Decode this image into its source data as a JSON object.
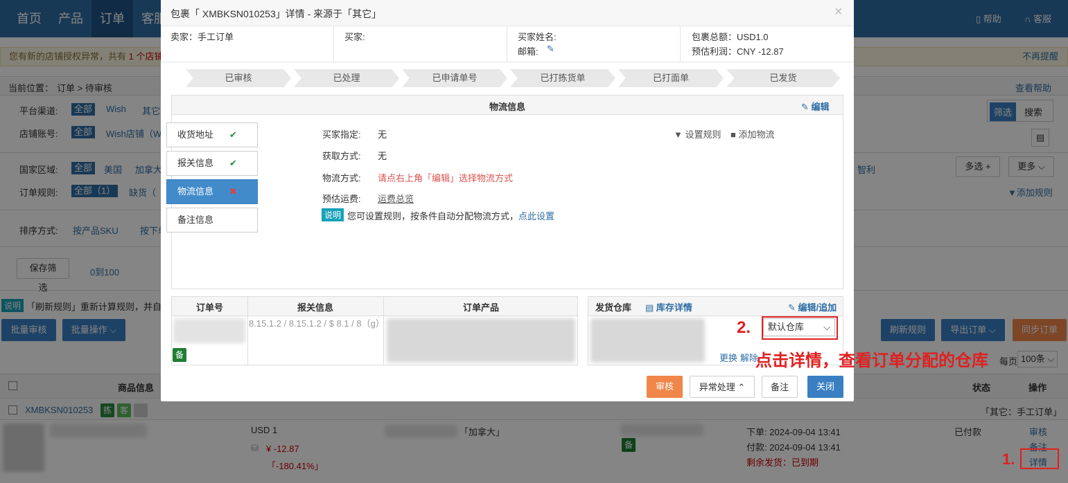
{
  "nav": {
    "items": [
      "首页",
      "产品",
      "订单",
      "客服"
    ],
    "help": "帮助",
    "service": "客服"
  },
  "notice": {
    "text_prefix": "您有新的店铺授权异常，共有",
    "text_count": "1 个店铺",
    "dismiss": "不再提醒"
  },
  "breadcrumb": {
    "label": "当前位置：",
    "path": "订单 > 待审核",
    "help": "查看帮助"
  },
  "filters": {
    "platform_label": "平台渠道:",
    "platform_all": "全部",
    "platform_wish": "Wish",
    "platform_other": "其它",
    "shop_label": "店铺账号:",
    "shop_all": "全部",
    "shop_wish": "Wish店铺（W",
    "region_label": "国家区域:",
    "region_all": "全部",
    "region_us": "美国",
    "region_ca": "加拿大",
    "region_cl": "智利",
    "multi": "多选 +",
    "more": "更多",
    "rule_label": "订单规则:",
    "rule_all": "全部（1）",
    "rule_lack": "缺货（",
    "add_rule": "添加规则",
    "sort_label": "排序方式:",
    "sort_sku": "按产品SKU",
    "sort_order": "按下单",
    "save_filter": "保存筛选",
    "range": "0到100",
    "filter_btn": "筛选",
    "search_btn": "搜索"
  },
  "info_bar": {
    "tag": "说明",
    "text": "「刷新规则」重新计算规则，并自"
  },
  "actions": {
    "batch_review": "批量审核",
    "batch_ops": "批量操作",
    "refresh": "刷新规则",
    "export": "导出订单",
    "sync": "同步订单",
    "page_size": "100条",
    "per_page": "每页"
  },
  "table": {
    "headers": {
      "product": "商品信息",
      "status": "状态",
      "op": "操作"
    },
    "order_no": "XMBKSN010253",
    "badges": [
      "拣",
      "客"
    ],
    "source": "「其它：手工订单」",
    "price": "USD 1",
    "profit_prefix": "¥",
    "profit": "-12.87",
    "margin": "「-180.41%」",
    "country": "「加拿大」",
    "bei": "备",
    "ordered_label": "下单:",
    "ordered_time": "2024-09-04 13:41",
    "paid_label": "付款:",
    "paid_time": "2024-09-04 13:41",
    "remaining": "剩余发货：已到期",
    "status": "已付款",
    "op_review": "审核",
    "op_note": "备注",
    "op_detail": "详情"
  },
  "modal": {
    "title": "包裹「 XMBKSN010253」详情 - 来源于「其它」",
    "close": "×",
    "seller_label": "卖家：",
    "seller": "手工订单",
    "buyer_label": "买家:",
    "buyer_name_label": "买家姓名:",
    "email_label": "邮箱:",
    "total_label": "包裹总额：",
    "total": "USD1.0",
    "profit_label": "预估利润：",
    "profit": "CNY -12.87",
    "steps": [
      "已审核",
      "已处理",
      "已申请单号",
      "已打拣货单",
      "已打面单",
      "已发货"
    ],
    "logistics_title": "物流信息",
    "edit": "编辑",
    "tabs": [
      "收货地址",
      "报关信息",
      "物流信息",
      "备注信息"
    ],
    "fields": {
      "assigned_label": "买家指定:",
      "assigned": "无",
      "method_get_label": "获取方式:",
      "method_get": "无",
      "method_label": "物流方式:",
      "method": "请点右上角「编辑」选择物流方式",
      "fee_label": "预估运费:",
      "fee": "运费总览"
    },
    "set_rule": "设置规则",
    "add_logistics": "添加物流",
    "tip_tag": "说明",
    "tip_text": "您可设置规则，按条件自动分配物流方式，",
    "tip_link": "点此设置",
    "grid": {
      "col_order": "订单号",
      "col_customs": "报关信息",
      "col_product": "订单产品",
      "customs_value": "8.15.1.2 / 8.15.1.2 / $ 8.1 / 8（g）",
      "bei": "备",
      "warehouse_label": "发货仓库",
      "stock_detail": "库存详情",
      "edit_add": "编辑/追加",
      "warehouse_select": "默认仓库",
      "change": "更换",
      "remove": "解除"
    },
    "buttons": {
      "review": "审核",
      "exception": "异常处理",
      "note": "备注",
      "close": "关闭"
    }
  },
  "annotations": {
    "step1": "1.",
    "step2": "2.",
    "caption": "点击详情，查看订单分配的仓库"
  },
  "colors": {
    "primary": "#2e6da4",
    "orange": "#f0864a",
    "red": "#e02020",
    "green": "#2a8a3e"
  }
}
